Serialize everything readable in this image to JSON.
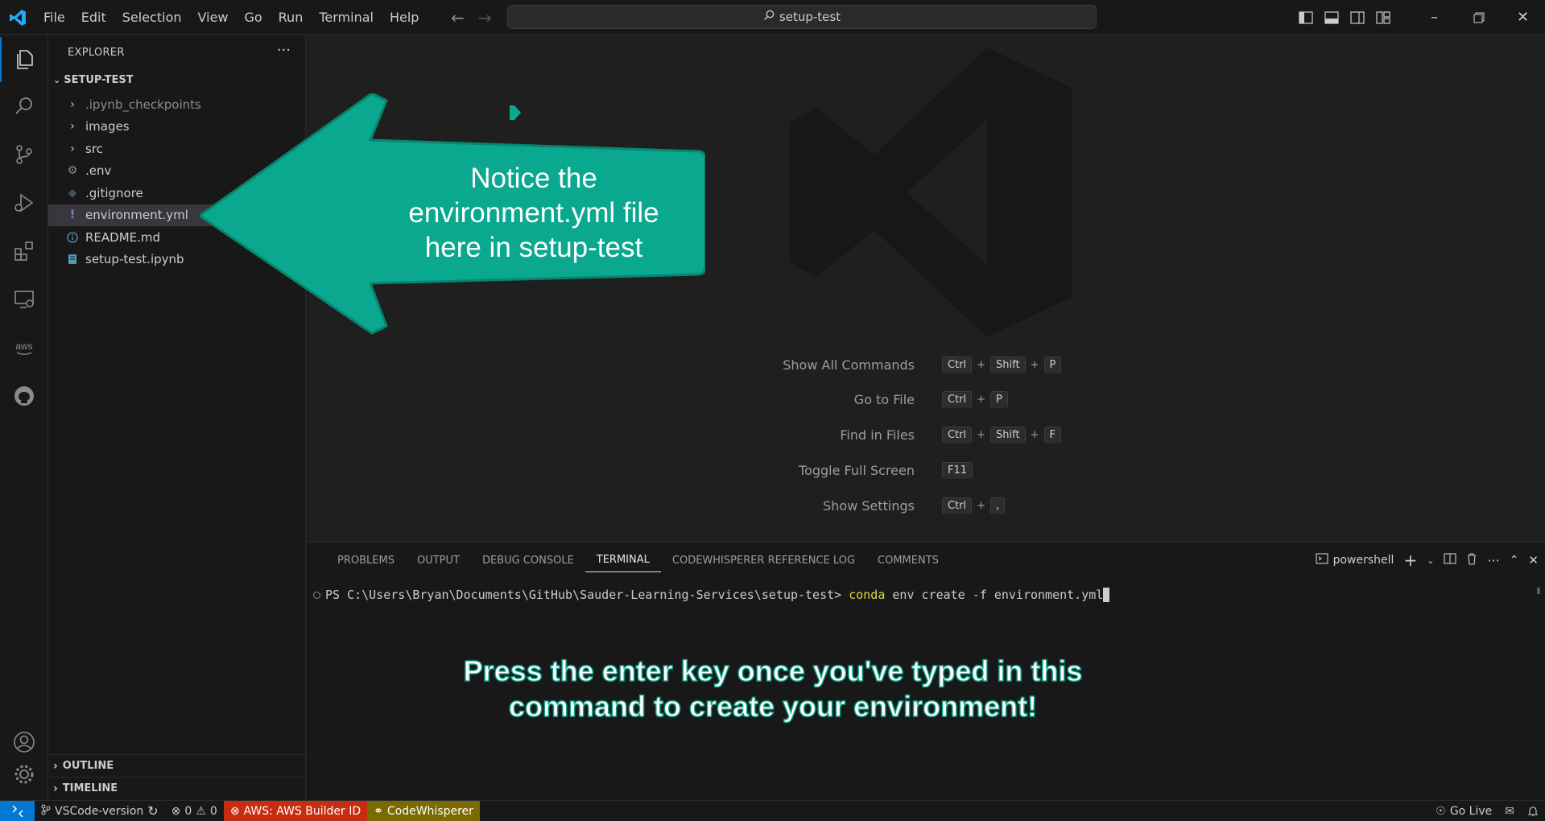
{
  "titlebar": {
    "menus": [
      "File",
      "Edit",
      "Selection",
      "View",
      "Go",
      "Run",
      "Terminal",
      "Help"
    ],
    "search_text": "setup-test"
  },
  "sidebar": {
    "header": "EXPLORER",
    "folder": "SETUP-TEST",
    "items": [
      {
        "label": ".ipynb_checkpoints",
        "type": "folder",
        "icon": "chevron-right-icon",
        "dim": true
      },
      {
        "label": "images",
        "type": "folder",
        "icon": "chevron-right-icon"
      },
      {
        "label": "src",
        "type": "folder",
        "icon": "chevron-right-icon"
      },
      {
        "label": ".env",
        "type": "file",
        "icon": "gear-icon"
      },
      {
        "label": ".gitignore",
        "type": "file",
        "icon": "git-icon"
      },
      {
        "label": "environment.yml",
        "type": "file",
        "icon": "yaml-icon",
        "selected": true
      },
      {
        "label": "README.md",
        "type": "file",
        "icon": "info-icon"
      },
      {
        "label": "setup-test.ipynb",
        "type": "file",
        "icon": "notebook-icon"
      }
    ],
    "outline": "OUTLINE",
    "timeline": "TIMELINE"
  },
  "editor": {
    "shortcuts": [
      {
        "label": "Show All Commands",
        "keys": [
          "Ctrl",
          "Shift",
          "P"
        ]
      },
      {
        "label": "Go to File",
        "keys": [
          "Ctrl",
          "P"
        ]
      },
      {
        "label": "Find in Files",
        "keys": [
          "Ctrl",
          "Shift",
          "F"
        ]
      },
      {
        "label": "Toggle Full Screen",
        "keys": [
          "F11"
        ]
      },
      {
        "label": "Show Settings",
        "keys": [
          "Ctrl",
          ","
        ]
      }
    ]
  },
  "panel": {
    "tabs": [
      "PROBLEMS",
      "OUTPUT",
      "DEBUG CONSOLE",
      "TERMINAL",
      "CODEWHISPERER REFERENCE LOG",
      "COMMENTS"
    ],
    "active_tab": "TERMINAL",
    "terminal_name": "powershell",
    "prompt": "PS C:\\Users\\Bryan\\Documents\\GitHub\\Sauder-Learning-Services\\setup-test> ",
    "command": "conda",
    "args": " env create -f environment.yml"
  },
  "statusbar": {
    "branch": "VSCode-version",
    "errors": "0",
    "warnings": "0",
    "aws": "AWS: AWS Builder ID",
    "codewhisperer": "CodeWhisperer",
    "go_live": "Go Live"
  },
  "annotations": {
    "callout_lines": [
      "Notice the",
      "environment.yml file",
      "here in setup-test"
    ],
    "note_lines": [
      "Press the enter key once you've typed in this",
      "command to create your environment!"
    ],
    "accent": "#10a38a"
  },
  "colors": {
    "accent_blue": "#0078d4",
    "aws_red": "#c72e0f",
    "codewhisperer_olive": "#7a6a00",
    "callout_teal": "#0aa88f"
  }
}
